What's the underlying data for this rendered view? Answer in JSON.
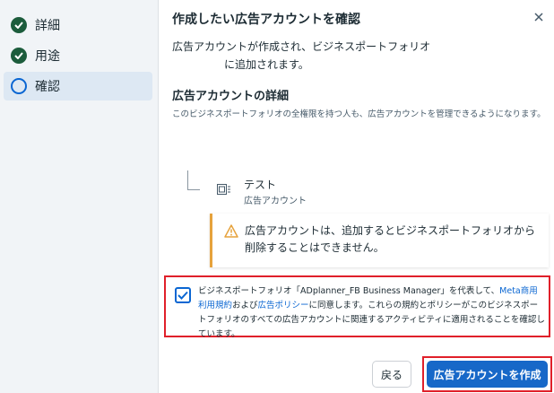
{
  "sidebar": {
    "steps": [
      {
        "label": "詳細",
        "status": "complete",
        "icon": "check-circle-icon"
      },
      {
        "label": "用途",
        "status": "complete",
        "icon": "check-circle-icon"
      },
      {
        "label": "確認",
        "status": "current",
        "icon": "radio-ring-icon"
      }
    ]
  },
  "dialog": {
    "title": "作成したい広告アカウントを確認",
    "close_icon": "close-icon",
    "message_line1": "広告アカウントが作成され、ビジネスポートフォリオ",
    "message_line2": "に追加されます。",
    "details_heading": "広告アカウントの詳細",
    "details_description": "このビジネスポートフォリオの全権限を持つ人も、広告アカウントを管理できるようになります。",
    "account": {
      "name": "テスト",
      "type": "広告アカウント",
      "icon": "ad-account-icon"
    },
    "warning": {
      "icon": "warning-triangle-icon",
      "text": "広告アカウントは、追加するとビジネスポートフォリオから削除することはできません。"
    },
    "consent": {
      "checked": true,
      "text_before": "ビジネスポートフォリオ「ADplanner_FB Business Manager」を代表して、",
      "link1": "Meta商用利用規約",
      "text_middle": "および",
      "link2": "広告ポリシー",
      "text_after": "に同意します。これらの規約とポリシーがこのビジネスポートフォリオのすべての広告アカウントに関連するアクティビティに適用されることを確認しています。"
    },
    "buttons": {
      "back": "戻る",
      "create": "広告アカウントを作成"
    }
  },
  "colors": {
    "sidebar_bg": "#f1f4f7",
    "active_step_bg": "#dde8f3",
    "complete_check": "#1c5c3c",
    "accent_blue": "#1768c8",
    "link_blue": "#0a66d2",
    "warning_orange": "#e6a23c",
    "highlight_red": "#e0202a"
  }
}
